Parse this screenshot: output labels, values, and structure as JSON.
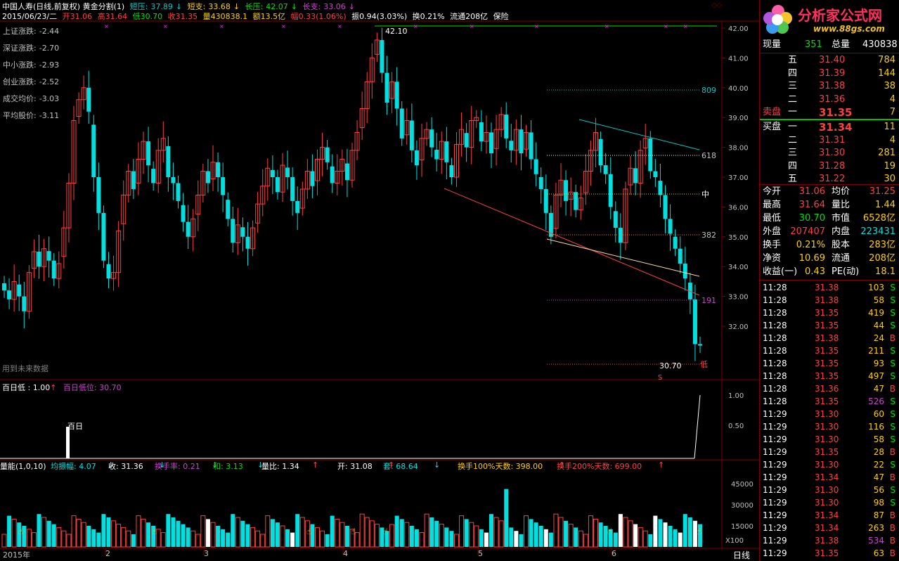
{
  "header": {
    "title": "中国人寿(日线,前复权) 黄金分割(1)",
    "short_press_label": "短压:",
    "short_press": "37.89",
    "short_support_label": "短支:",
    "short_support": "33.68",
    "long_press_label": "长压:",
    "long_press": "42.07",
    "long_support_label": "长支:",
    "long_support": "33.06",
    "line2": {
      "date": "2015/06/23/二",
      "open": "开31.06",
      "high": "高31.64",
      "low": "低30.70",
      "close": "收31.35",
      "vol": "量430838.1",
      "amt": "额13.5亿",
      "amp": "幅0.33(1.06%)",
      "swing": "振0.94(3.03%)",
      "turnover": "换0.21%",
      "float": "流通208亿",
      "sector": "保险"
    }
  },
  "logo": {
    "name": "分析家公式网",
    "url": "www.88gs.com"
  },
  "index_stats": [
    {
      "label": "上证涨跌:",
      "value": "-2.44"
    },
    {
      "label": "深证涨跌:",
      "value": "-2.70"
    },
    {
      "label": "中小涨跌:",
      "value": "-2.93"
    },
    {
      "label": "创业涨跌:",
      "value": "-2.52"
    },
    {
      "label": "成交均价:",
      "value": "-3.03"
    },
    {
      "label": "平均股价:",
      "value": "-3.11"
    }
  ],
  "main_chart": {
    "y_labels": [
      "42.00",
      "41.00",
      "40.00",
      "39.00",
      "38.00",
      "37.00",
      "36.00",
      "35.00",
      "34.00",
      "33.00",
      "32.00"
    ],
    "annotations": {
      "high_label": "42.10",
      "fib_809": "809",
      "fib_618": "618",
      "fib_mid": "中",
      "fib_382": "382",
      "fib_191": "191",
      "low_label": "30.70",
      "low_tag": "低",
      "s_tag": "S"
    },
    "future_data_note": "用到未来数据"
  },
  "sub_chart1": {
    "legend_name": "百日低",
    "legend_value": ": 1.00",
    "legend2_name": "百日低位:",
    "legend2_value": "30.70",
    "marker_label": "百日",
    "y_labels": [
      "1.00",
      "0.50"
    ]
  },
  "sub_chart2": {
    "legend": [
      {
        "text": "量能(1,0,10)"
      },
      {
        "text": "均振幅: 4.07"
      },
      {
        "text": "收: 31.36"
      },
      {
        "text": "换手率: 0.21"
      },
      {
        "text": "和: 3.13"
      },
      {
        "text": "量比: 1.34"
      },
      {
        "text": "开: 31.08"
      },
      {
        "text": "套: 68.64"
      },
      {
        "text": "换手100%天数: 398.00"
      },
      {
        "text": "换手200%天数: 699.00"
      }
    ],
    "y_labels": [
      "45000",
      "30000",
      "15000"
    ],
    "scale_tag": "X100"
  },
  "x_axis": {
    "labels": [
      "2015年",
      "2",
      "3",
      "4",
      "5",
      "6"
    ],
    "period": "日线"
  },
  "quote": {
    "now_vol_label": "现量",
    "now_vol": "351",
    "total_vol_label": "总量",
    "total_vol": "430838",
    "sell_label": "卖盘",
    "buy_label": "买盘",
    "asks": [
      {
        "lv": "五",
        "price": "31.40",
        "vol": "784"
      },
      {
        "lv": "四",
        "price": "31.39",
        "vol": "144"
      },
      {
        "lv": "三",
        "price": "31.38",
        "vol": "38"
      },
      {
        "lv": "二",
        "price": "31.36",
        "vol": "4"
      },
      {
        "lv": "一",
        "price": "31.35",
        "vol": "7"
      }
    ],
    "bids": [
      {
        "lv": "一",
        "price": "31.34",
        "vol": "11"
      },
      {
        "lv": "二",
        "price": "31.31",
        "vol": "4"
      },
      {
        "lv": "三",
        "price": "31.30",
        "vol": "281"
      },
      {
        "lv": "四",
        "price": "31.28",
        "vol": "19"
      },
      {
        "lv": "五",
        "price": "31.22",
        "vol": "30"
      }
    ],
    "stats": [
      [
        "今开",
        "31.06",
        "均价",
        "31.25"
      ],
      [
        "最高",
        "31.64",
        "量比",
        "1.44"
      ],
      [
        "最低",
        "30.70",
        "市值",
        "6528亿"
      ],
      [
        "外盘",
        "207407",
        "内盘",
        "223431"
      ],
      [
        "换手",
        "0.21%",
        "股本",
        "283亿"
      ],
      [
        "净资",
        "10.69",
        "流通",
        "208亿"
      ],
      [
        "收益(一)",
        "0.43",
        "PE(动)",
        "18.1"
      ]
    ]
  },
  "ticks": [
    [
      "11:28",
      "31.38",
      "103",
      "S"
    ],
    [
      "11:28",
      "31.38",
      "58",
      "S"
    ],
    [
      "11:28",
      "31.35",
      "419",
      "S"
    ],
    [
      "11:28",
      "31.35",
      "44",
      "S"
    ],
    [
      "11:28",
      "31.38",
      "24",
      "B"
    ],
    [
      "11:28",
      "31.35",
      "211",
      "S"
    ],
    [
      "11:28",
      "31.35",
      "93",
      "S"
    ],
    [
      "11:28",
      "31.35",
      "497",
      "S"
    ],
    [
      "11:28",
      "31.36",
      "47",
      "B"
    ],
    [
      "11:28",
      "31.35",
      "526",
      "S"
    ],
    [
      "11:29",
      "31.30",
      "60",
      "S"
    ],
    [
      "11:29",
      "31.30",
      "116",
      "S"
    ],
    [
      "11:29",
      "31.30",
      "58",
      "S"
    ],
    [
      "11:29",
      "31.35",
      "28",
      "B"
    ],
    [
      "11:29",
      "31.30",
      "22",
      "S"
    ],
    [
      "11:29",
      "31.34",
      "47",
      "B"
    ],
    [
      "11:29",
      "31.30",
      "56",
      "S"
    ],
    [
      "11:29",
      "31.30",
      "98",
      "S"
    ],
    [
      "11:29",
      "31.34",
      "87",
      "B"
    ],
    [
      "11:29",
      "31.34",
      "263",
      "B"
    ],
    [
      "11:29",
      "31.38",
      "534",
      "B"
    ],
    [
      "11:29",
      "31.35",
      "63",
      "B"
    ]
  ],
  "colors": {
    "up": "#ff4040",
    "down": "#00e0e0",
    "grid": "#800000"
  }
}
